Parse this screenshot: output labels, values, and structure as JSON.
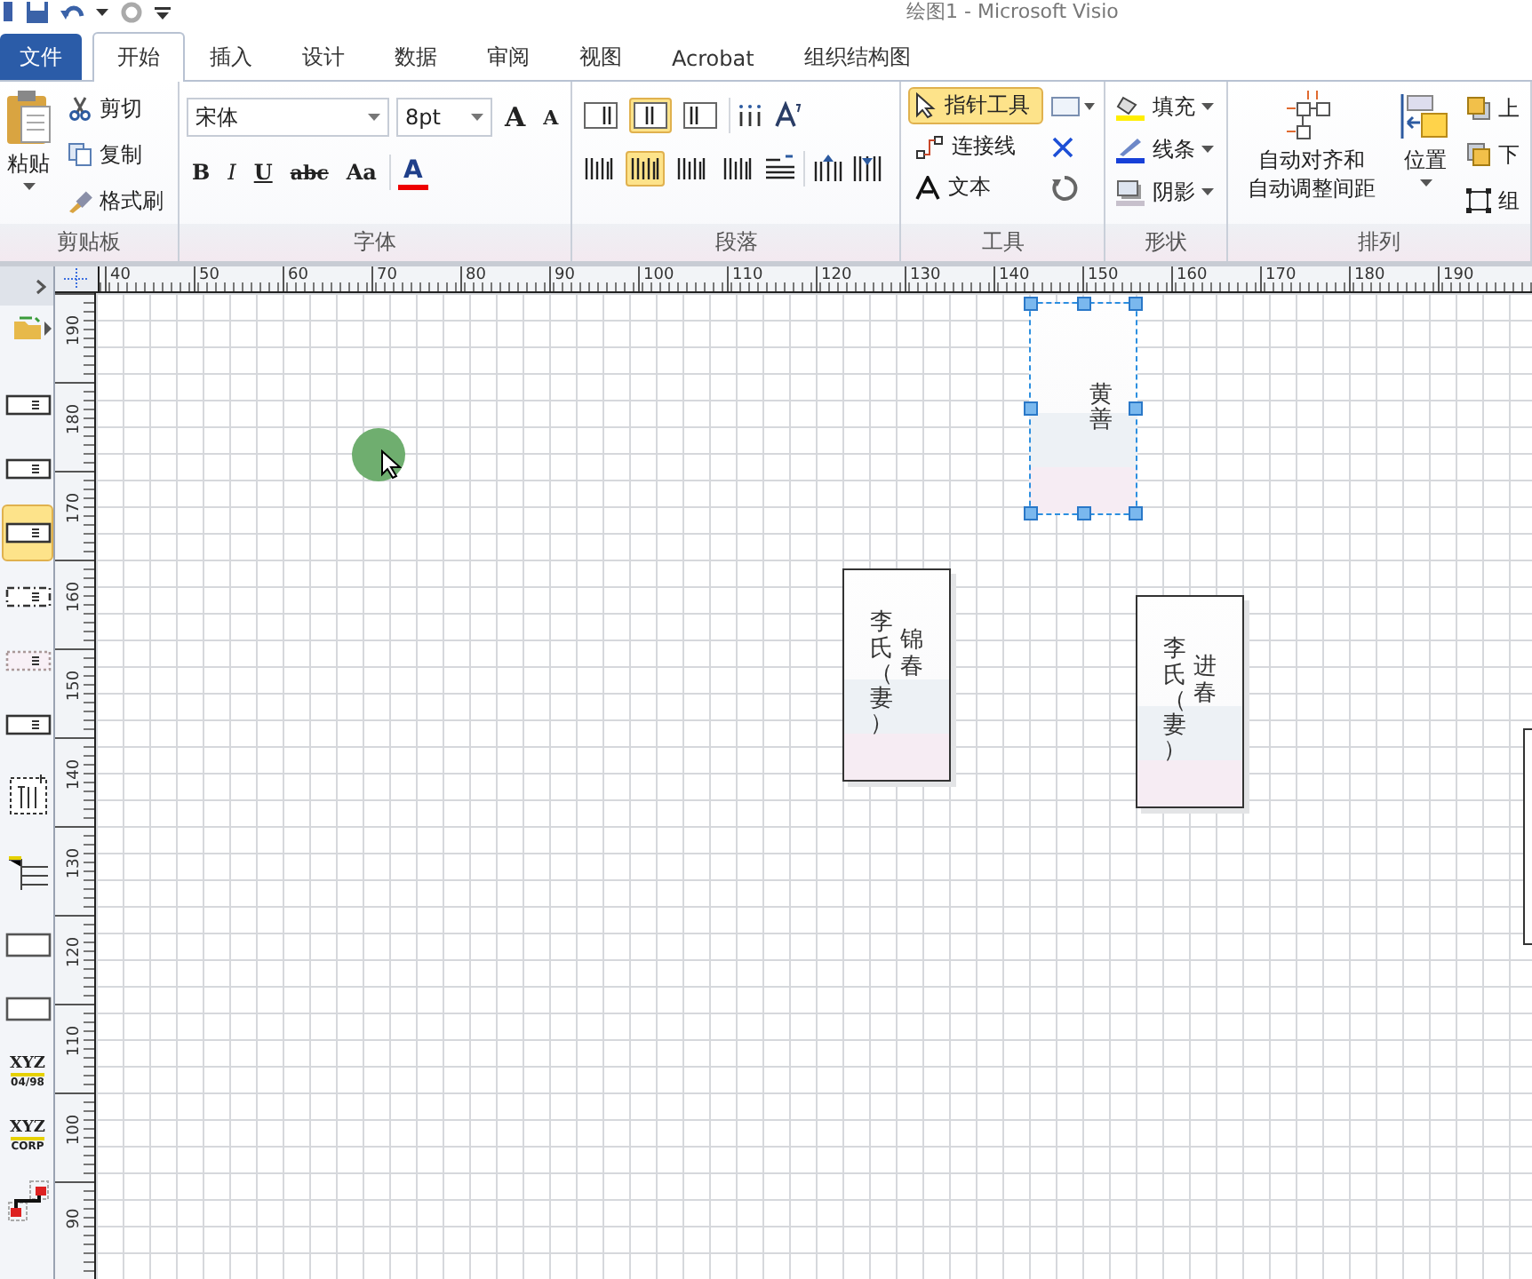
{
  "window": {
    "title": "绘图1 - Microsoft Visio"
  },
  "tabs": [
    {
      "label": "文件",
      "kind": "file",
      "selected": false
    },
    {
      "label": "开始",
      "kind": "tab",
      "selected": true
    },
    {
      "label": "插入",
      "kind": "tab",
      "selected": false
    },
    {
      "label": "设计",
      "kind": "tab",
      "selected": false
    },
    {
      "label": "数据",
      "kind": "tab",
      "selected": false
    },
    {
      "label": "审阅",
      "kind": "tab",
      "selected": false
    },
    {
      "label": "视图",
      "kind": "tab",
      "selected": false
    },
    {
      "label": "Acrobat",
      "kind": "tab",
      "selected": false
    },
    {
      "label": "组织结构图",
      "kind": "tab",
      "selected": false
    }
  ],
  "clipboard": {
    "label": "剪贴板",
    "paste": "粘贴",
    "commands": [
      "剪切",
      "复制",
      "格式刷"
    ]
  },
  "font": {
    "label": "字体",
    "family": "宋体",
    "size": "8pt",
    "grow": "A",
    "shrink": "A",
    "styles": [
      "B",
      "I",
      "U",
      "abc",
      "Aa"
    ],
    "color_letter": "A"
  },
  "paragraph": {
    "label": "段落",
    "align": [
      {
        "selected": false
      },
      {
        "selected": true
      },
      {
        "selected": false
      }
    ],
    "spacing": [
      {
        "selected": false
      },
      {
        "selected": true
      },
      {
        "selected": false
      },
      {
        "selected": false
      }
    ]
  },
  "tools": {
    "label": "工具",
    "items": [
      {
        "label": "指针工具",
        "selected": true
      },
      {
        "label": "连接线",
        "selected": false
      },
      {
        "label": "文本",
        "selected": false
      }
    ]
  },
  "shape": {
    "label": "形状",
    "items": [
      "填充",
      "线条",
      "阴影"
    ]
  },
  "arrange": {
    "label": "排列",
    "auto_space": [
      "自动对齐和",
      "自动调整间距"
    ],
    "position": "位置",
    "order": [
      "上",
      "下",
      "组"
    ]
  },
  "stencil": {
    "items": [
      {
        "kind": "box",
        "selected": false
      },
      {
        "kind": "box",
        "selected": false
      },
      {
        "kind": "box",
        "selected": true
      },
      {
        "kind": "dashdot",
        "selected": false
      },
      {
        "kind": "dotted",
        "selected": false
      },
      {
        "kind": "box",
        "selected": false
      },
      {
        "kind": "org",
        "selected": false
      },
      {
        "kind": "tree",
        "selected": false
      },
      {
        "kind": "plain",
        "selected": false
      },
      {
        "kind": "plain",
        "selected": false
      },
      {
        "kind": "logo",
        "title": "XYZ",
        "caption": "04/98",
        "selected": false
      },
      {
        "kind": "logo",
        "title": "XYZ",
        "caption": "CORP",
        "selected": false
      },
      {
        "kind": "connector",
        "selected": false
      }
    ]
  },
  "rulers": {
    "horizontal": [
      "40",
      "50",
      "60",
      "70",
      "80",
      "90",
      "100",
      "110",
      "120",
      "130",
      "140",
      "150",
      "160",
      "170",
      "180",
      "190"
    ],
    "vertical": [
      "190",
      "180",
      "170",
      "160",
      "150",
      "140",
      "130",
      "120",
      "110",
      "100",
      "90"
    ]
  },
  "canvas": {
    "shapes": [
      {
        "name": "黄善",
        "selected": true
      },
      {
        "name": "锦春",
        "spouse": "李氏（妻）",
        "selected": false
      },
      {
        "name": "进春",
        "spouse": "李氏（妻）",
        "selected": false
      }
    ]
  }
}
